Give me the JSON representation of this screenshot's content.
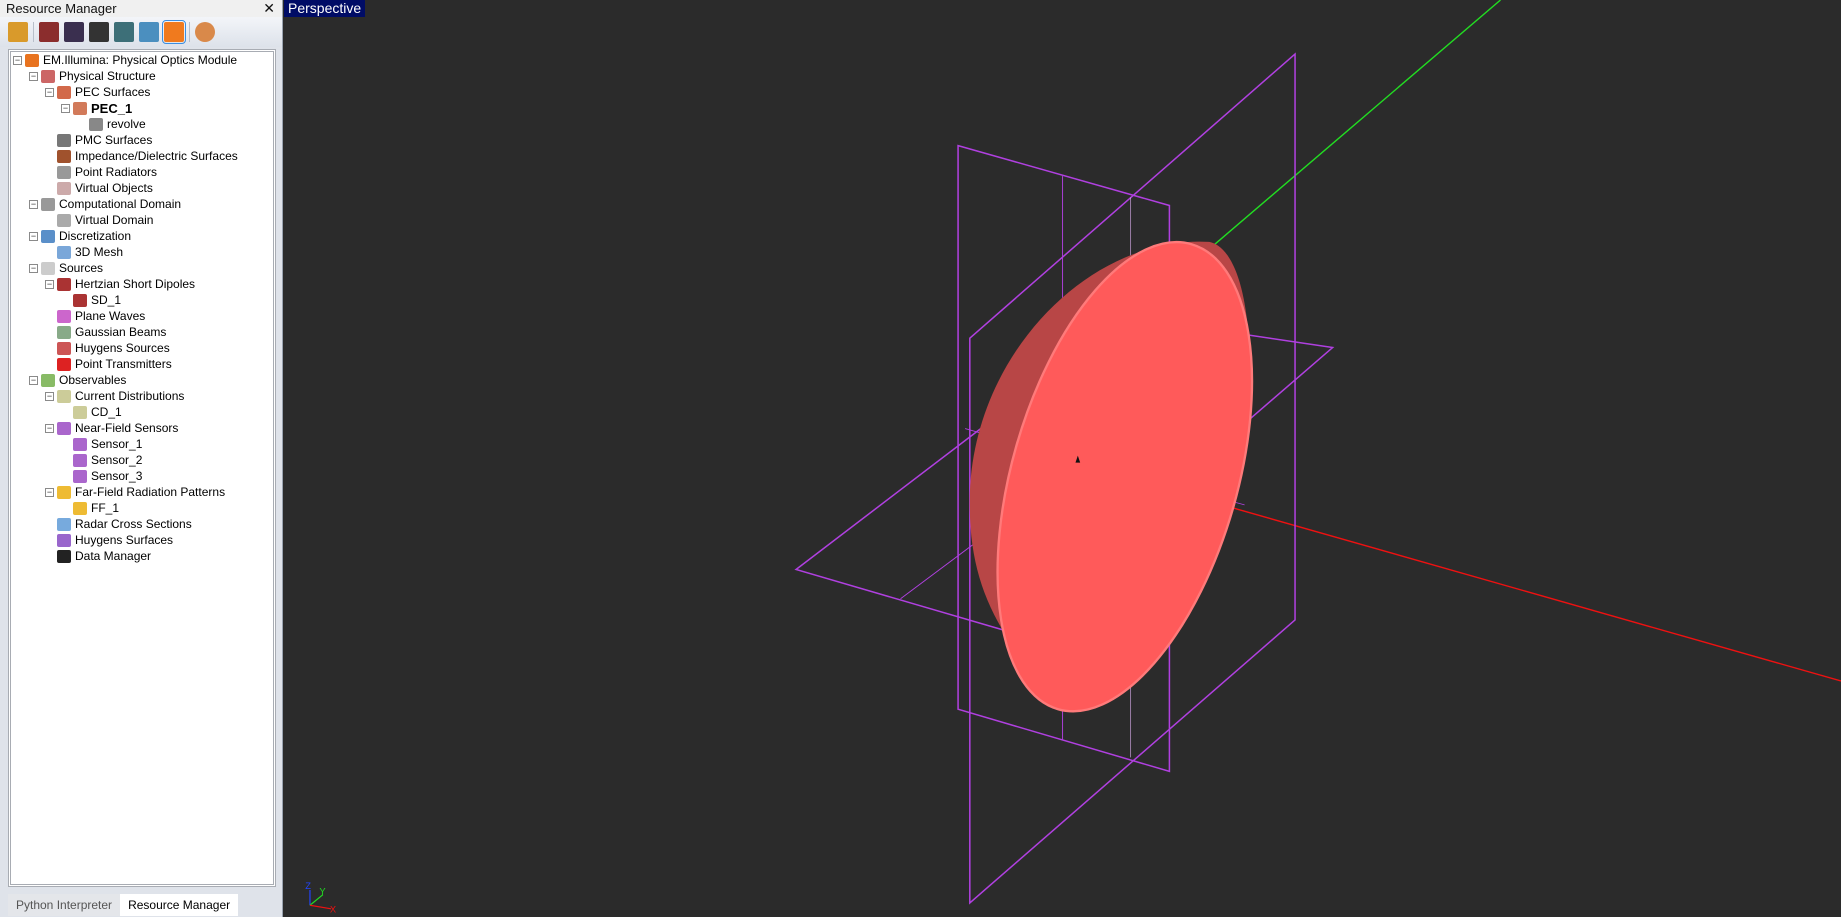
{
  "panel": {
    "title": "Resource Manager",
    "close": "✕"
  },
  "toolbar": [
    "em-tool-icon",
    "pec-icon",
    "wave-icon",
    "molecule-icon",
    "ground-icon",
    "rcs-icon",
    "po-module-icon",
    "target-icon"
  ],
  "tree": [
    {
      "level": 0,
      "pm": "−",
      "label": "EM.Illumina: Physical Optics Module",
      "color": "#e8731f"
    },
    {
      "level": 1,
      "pm": "−",
      "label": "Physical Structure",
      "color": "#c66"
    },
    {
      "level": 2,
      "pm": "−",
      "label": "PEC Surfaces",
      "color": "#d2694a"
    },
    {
      "level": 3,
      "pm": "−",
      "label": "PEC_1",
      "color": "#d27a5a",
      "bold": true
    },
    {
      "level": 4,
      "pm": "",
      "label": "revolve",
      "color": "#888"
    },
    {
      "level": 2,
      "pm": "",
      "label": "PMC Surfaces",
      "color": "#777"
    },
    {
      "level": 2,
      "pm": "",
      "label": "Impedance/Dielectric Surfaces",
      "color": "#a0522d"
    },
    {
      "level": 2,
      "pm": "",
      "label": "Point Radiators",
      "color": "#999"
    },
    {
      "level": 2,
      "pm": "",
      "label": "Virtual Objects",
      "color": "#caa"
    },
    {
      "level": 1,
      "pm": "−",
      "label": "Computational Domain",
      "color": "#999"
    },
    {
      "level": 2,
      "pm": "",
      "label": "Virtual Domain",
      "color": "#aaa"
    },
    {
      "level": 1,
      "pm": "−",
      "label": "Discretization",
      "color": "#5a8fc9"
    },
    {
      "level": 2,
      "pm": "",
      "label": "3D Mesh",
      "color": "#7aa7d9"
    },
    {
      "level": 1,
      "pm": "−",
      "label": "Sources",
      "color": "#ccc"
    },
    {
      "level": 2,
      "pm": "−",
      "label": "Hertzian Short Dipoles",
      "color": "#a33"
    },
    {
      "level": 3,
      "pm": "",
      "label": "SD_1",
      "color": "#a33"
    },
    {
      "level": 2,
      "pm": "",
      "label": "Plane Waves",
      "color": "#c6c"
    },
    {
      "level": 2,
      "pm": "",
      "label": "Gaussian Beams",
      "color": "#8a8"
    },
    {
      "level": 2,
      "pm": "",
      "label": "Huygens Sources",
      "color": "#c55"
    },
    {
      "level": 2,
      "pm": "",
      "label": "Point Transmitters",
      "color": "#d22"
    },
    {
      "level": 1,
      "pm": "−",
      "label": "Observables",
      "color": "#8b6"
    },
    {
      "level": 2,
      "pm": "−",
      "label": "Current Distributions",
      "color": "#cc9"
    },
    {
      "level": 3,
      "pm": "",
      "label": "CD_1",
      "color": "#cc9"
    },
    {
      "level": 2,
      "pm": "−",
      "label": "Near-Field Sensors",
      "color": "#a6c"
    },
    {
      "level": 3,
      "pm": "",
      "label": "Sensor_1",
      "color": "#a6c"
    },
    {
      "level": 3,
      "pm": "",
      "label": "Sensor_2",
      "color": "#a6c"
    },
    {
      "level": 3,
      "pm": "",
      "label": "Sensor_3",
      "color": "#a6c"
    },
    {
      "level": 2,
      "pm": "−",
      "label": "Far-Field Radiation Patterns",
      "color": "#eb3"
    },
    {
      "level": 3,
      "pm": "",
      "label": "FF_1",
      "color": "#eb3"
    },
    {
      "level": 2,
      "pm": "",
      "label": "Radar Cross Sections",
      "color": "#7ad"
    },
    {
      "level": 2,
      "pm": "",
      "label": "Huygens Surfaces",
      "color": "#96c"
    },
    {
      "level": 2,
      "pm": "",
      "label": "Data Manager",
      "color": "#222"
    }
  ],
  "tabs": [
    {
      "label": "Python Interpreter",
      "active": false
    },
    {
      "label": "Resource Manager",
      "active": true
    }
  ],
  "viewport": {
    "label": "Perspective",
    "axes": {
      "x": "X",
      "y": "Y",
      "z": "Z"
    }
  }
}
